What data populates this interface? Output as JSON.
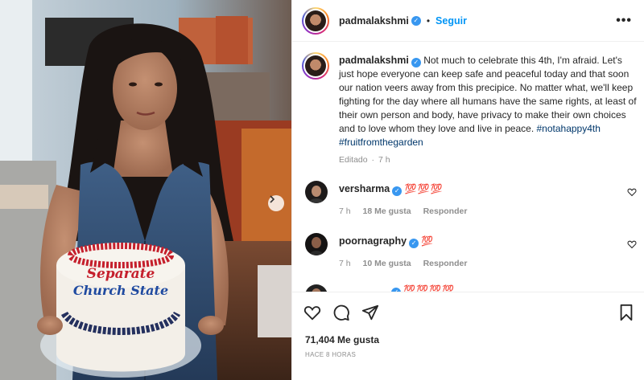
{
  "post": {
    "photo": {
      "description": "Woman in denim top holding a frosted cake",
      "cake_text_line1": "Separate",
      "cake_text_line2": "Church State"
    }
  },
  "header": {
    "username": "padmalakshmi",
    "separator": "•",
    "follow_label": "Seguir",
    "more_icon": "more-horizontal-icon"
  },
  "caption": {
    "username": "padmalakshmi",
    "text": "Not much to celebrate this 4th, I'm afraid. Let's just hope everyone can keep safe and peaceful today and that soon our nation veers away from this precipice. No matter what, we'll keep fighting for the day where all humans have the same rights, at least of their own person and body, have privacy to make their own choices and to love whom they love and live in peace.",
    "hashtags": "#notahappy4th #fruitfromthegarden",
    "edited": "Editado",
    "dot": "·",
    "age": "7 h"
  },
  "comments": [
    {
      "username": "versharma",
      "text": "💯💯💯",
      "age": "7 h",
      "likes": "18 Me gusta",
      "reply": "Responder"
    },
    {
      "username": "poornagraphy",
      "text": "💯",
      "age": "7 h",
      "likes": "10 Me gusta",
      "reply": "Responder"
    },
    {
      "username": "",
      "text": "💯💯💯💯",
      "age": "",
      "likes": "",
      "reply": ""
    }
  ],
  "footer": {
    "likes": "71,404 Me gusta",
    "timestamp": "HACE 8 HORAS"
  },
  "colors": {
    "link": "#0095f6",
    "hashtag": "#00376b",
    "verified": "#3897f0",
    "muted": "#8e8e8e"
  }
}
